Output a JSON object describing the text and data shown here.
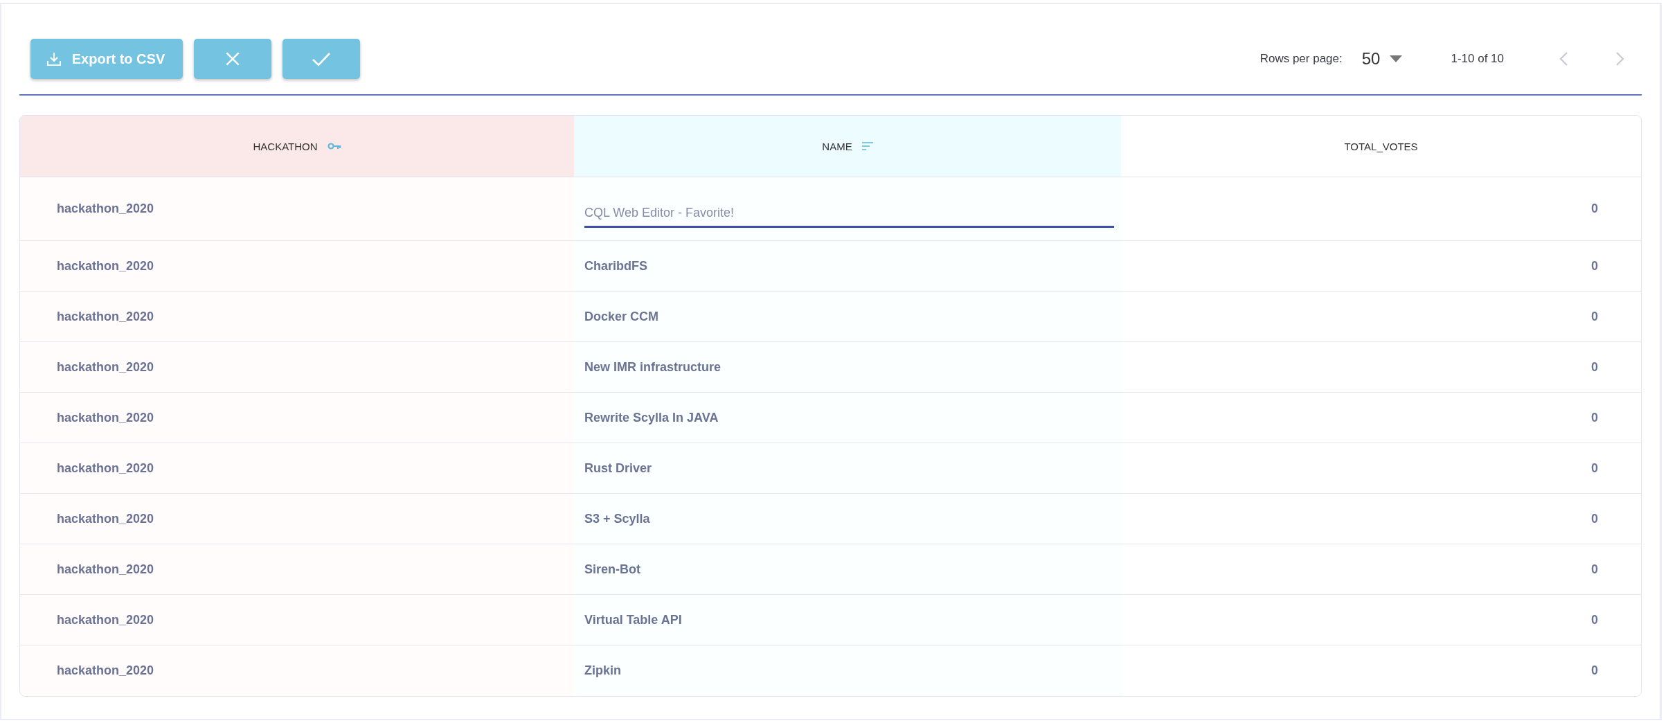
{
  "toolbar": {
    "buttons": [
      {
        "kind": "export",
        "label": "Export to CSV"
      },
      {
        "kind": "cancel"
      },
      {
        "kind": "confirm"
      }
    ]
  },
  "pagination": {
    "rows_per_page_label": "Rows per page:",
    "rows_per_page": "50",
    "range": "1-10 of 10",
    "prev_disabled": true,
    "next_disabled": true
  },
  "table": {
    "columns": [
      {
        "label": "HACKATHON",
        "kind": "partition_key"
      },
      {
        "label": "NAME",
        "kind": "clustering_key"
      },
      {
        "label": "TOTAL_VOTES",
        "kind": "regular"
      }
    ],
    "rows": [
      {
        "cells": [
          "hackathon_2020",
          "CQL Web Editor - Favorite!",
          "0"
        ],
        "editing": true
      },
      {
        "cells": [
          "hackathon_2020",
          "CharibdFS",
          "0"
        ],
        "editing": false
      },
      {
        "cells": [
          "hackathon_2020",
          "Docker CCM",
          "0"
        ],
        "editing": false
      },
      {
        "cells": [
          "hackathon_2020",
          "New IMR infrastructure",
          "0"
        ],
        "editing": false
      },
      {
        "cells": [
          "hackathon_2020",
          "Rewrite Scylla In JAVA",
          "0"
        ],
        "editing": false
      },
      {
        "cells": [
          "hackathon_2020",
          "Rust Driver",
          "0"
        ],
        "editing": false
      },
      {
        "cells": [
          "hackathon_2020",
          "S3 + Scylla",
          "0"
        ],
        "editing": false
      },
      {
        "cells": [
          "hackathon_2020",
          "Siren-Bot",
          "0"
        ],
        "editing": false
      },
      {
        "cells": [
          "hackathon_2020",
          "Virtual Table API",
          "0"
        ],
        "editing": false
      },
      {
        "cells": [
          "hackathon_2020",
          "Zipkin",
          "0"
        ],
        "editing": false
      }
    ]
  }
}
